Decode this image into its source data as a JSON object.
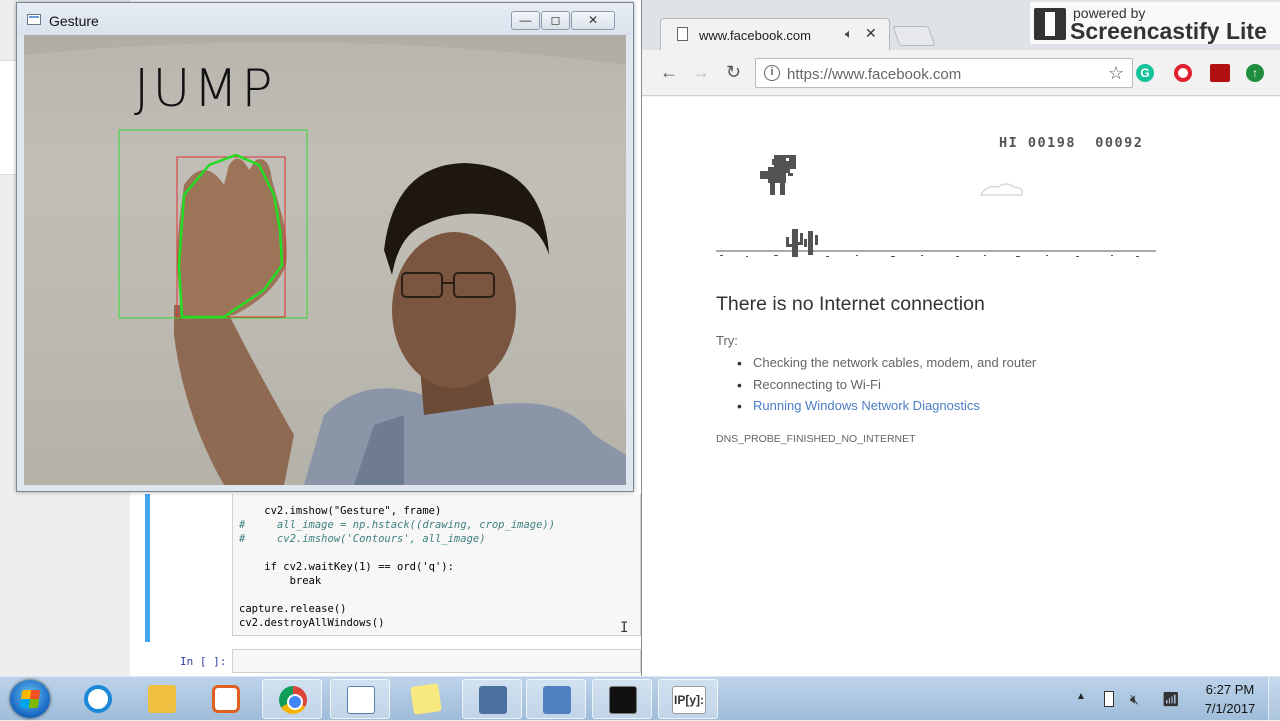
{
  "gesture_window": {
    "title": "Gesture",
    "overlay_text": "JUMP",
    "buttons": {
      "minimize": "—",
      "maximize": "◻",
      "close": "✕"
    }
  },
  "jupyter": {
    "code_lines": [
      "    cv2.imshow(\"Gesture\", frame)",
      "#     all_image = np.hstack((drawing, crop_image))",
      "#     cv2.imshow('Contours', all_image)",
      "",
      "    if cv2.waitKey(1) == ord('q'):",
      "        break",
      "",
      "capture.release()",
      "cv2.destroyAllWindows()"
    ],
    "in_prompt": "In [ ]:"
  },
  "chrome": {
    "tab_title": "www.facebook.com",
    "url": "https://www.facebook.com",
    "watermark_powered": "powered by",
    "watermark_brand": "Screencastify Lite",
    "dino_page": {
      "hi_score": "HI 00198",
      "score": "00092",
      "title": "There is no Internet connection",
      "try_label": "Try:",
      "suggestions": [
        "Checking the network cables, modem, and router",
        "Reconnecting to Wi-Fi",
        "Running Windows Network Diagnostics"
      ],
      "error_code": "DNS_PROBE_FINISHED_NO_INTERNET"
    }
  },
  "taskbar": {
    "items": [
      "internet-explorer",
      "windows-explorer",
      "media-player",
      "google-chrome",
      "wordpad",
      "sticky-notes",
      "security",
      "network",
      "command-prompt",
      "ipython"
    ],
    "ipython_label": "IP[y]:",
    "clock_time": "6:27 PM",
    "clock_date": "7/1/2017"
  },
  "colors": {
    "jupyter_cell_border": "#42a5f5",
    "link": "#4d7dc6",
    "contour_green": "#22dd22",
    "bbox_red": "#e03030"
  }
}
